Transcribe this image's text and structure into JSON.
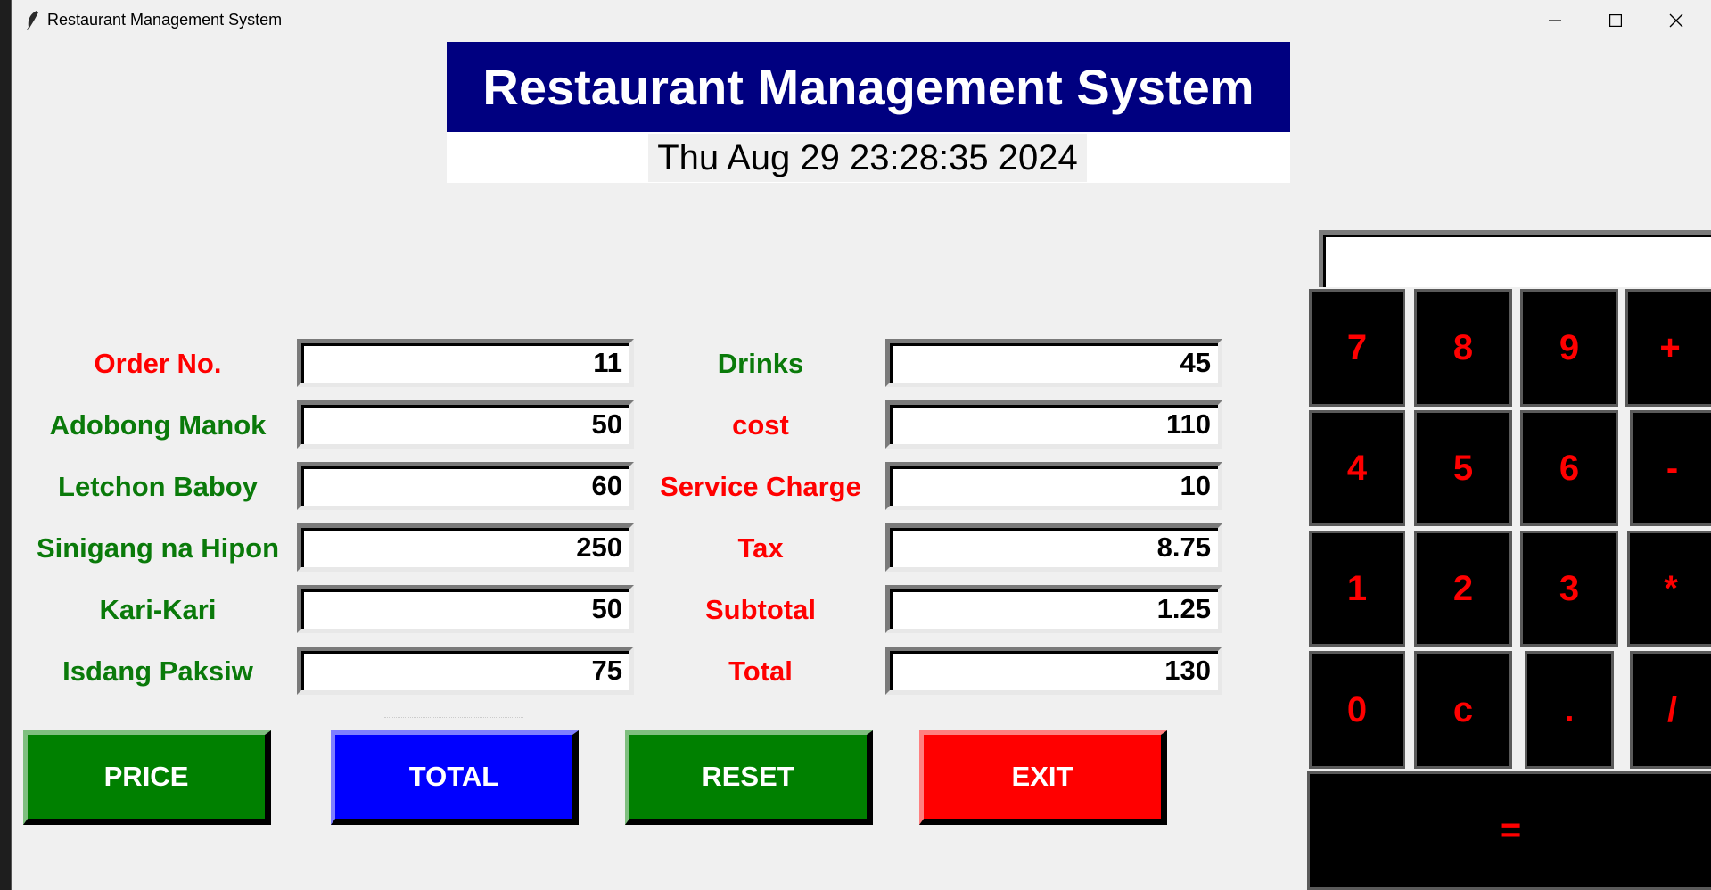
{
  "window": {
    "title": "Restaurant Management System"
  },
  "header": {
    "title": "Restaurant Management System",
    "datetime": "Thu Aug 29 23:28:35 2024"
  },
  "left_fields": [
    {
      "label": "Order No.",
      "value": "11",
      "label_color": "#ff0000"
    },
    {
      "label": "Adobong Manok",
      "value": "50",
      "label_color": "#0a7a0a"
    },
    {
      "label": "Letchon Baboy",
      "value": "60",
      "label_color": "#0a7a0a"
    },
    {
      "label": "Sinigang na Hipon",
      "value": "250",
      "label_color": "#0a7a0a"
    },
    {
      "label": "Kari-Kari",
      "value": "50",
      "label_color": "#0a7a0a"
    },
    {
      "label": "Isdang Paksiw",
      "value": "75",
      "label_color": "#0a7a0a"
    }
  ],
  "right_fields": [
    {
      "label": "Drinks",
      "value": "45",
      "label_color": "#0a7a0a"
    },
    {
      "label": "cost",
      "value": "110",
      "label_color": "#ff0000"
    },
    {
      "label": "Service Charge",
      "value": "10",
      "label_color": "#ff0000"
    },
    {
      "label": "Tax",
      "value": "8.75",
      "label_color": "#ff0000"
    },
    {
      "label": "Subtotal",
      "value": "1.25",
      "label_color": "#ff0000"
    },
    {
      "label": "Total",
      "value": "130",
      "label_color": "#ff0000"
    }
  ],
  "buttons": {
    "price": "PRICE",
    "total": "TOTAL",
    "reset": "RESET",
    "exit": "EXIT"
  },
  "calculator": {
    "display": "",
    "keys": [
      "7",
      "8",
      "9",
      "+",
      "4",
      "5",
      "6",
      "-",
      "1",
      "2",
      "3",
      "*",
      "0",
      "c",
      ".",
      "/"
    ],
    "equals": "="
  },
  "colors": {
    "header_bg": "#000080",
    "green": "#008000",
    "blue": "#0000ff",
    "red": "#ff0000",
    "key_bg": "#000000",
    "key_text": "#ff0000"
  }
}
